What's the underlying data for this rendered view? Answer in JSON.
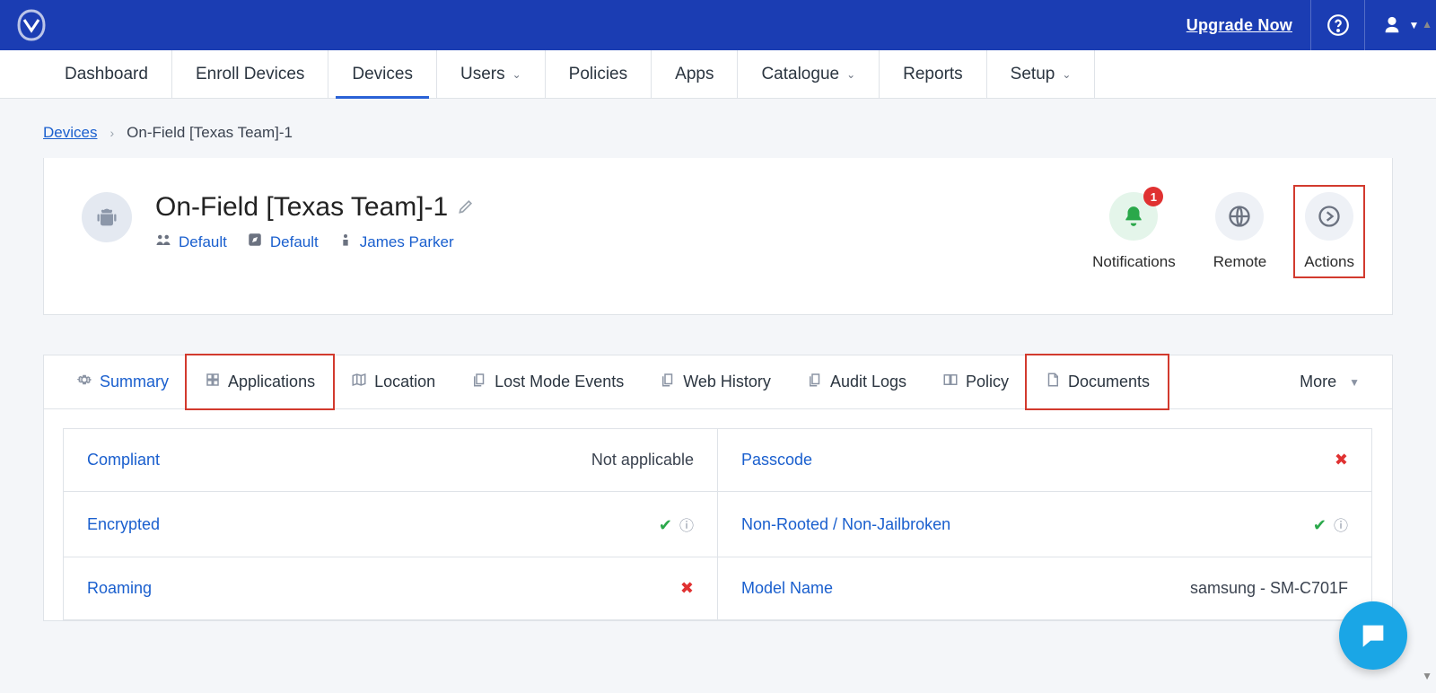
{
  "topbar": {
    "upgrade_label": "Upgrade Now"
  },
  "nav": [
    {
      "label": "Dashboard",
      "dropdown": false,
      "active": false
    },
    {
      "label": "Enroll Devices",
      "dropdown": false,
      "active": false
    },
    {
      "label": "Devices",
      "dropdown": false,
      "active": true
    },
    {
      "label": "Users",
      "dropdown": true,
      "active": false
    },
    {
      "label": "Policies",
      "dropdown": false,
      "active": false
    },
    {
      "label": "Apps",
      "dropdown": false,
      "active": false
    },
    {
      "label": "Catalogue",
      "dropdown": true,
      "active": false
    },
    {
      "label": "Reports",
      "dropdown": false,
      "active": false
    },
    {
      "label": "Setup",
      "dropdown": true,
      "active": false
    }
  ],
  "breadcrumb": {
    "root": "Devices",
    "current": "On-Field [Texas Team]-1"
  },
  "device": {
    "name": "On-Field [Texas Team]-1",
    "group": "Default",
    "profile": "Default",
    "owner": "James Parker"
  },
  "actions": {
    "notifications": {
      "label": "Notifications",
      "badge": "1"
    },
    "remote": {
      "label": "Remote"
    },
    "actions": {
      "label": "Actions"
    }
  },
  "tabs": [
    {
      "label": "Summary",
      "icon": "gear",
      "active": true,
      "highlight": false
    },
    {
      "label": "Applications",
      "icon": "grid",
      "active": false,
      "highlight": true
    },
    {
      "label": "Location",
      "icon": "map",
      "active": false,
      "highlight": false
    },
    {
      "label": "Lost Mode Events",
      "icon": "copy",
      "active": false,
      "highlight": false
    },
    {
      "label": "Web History",
      "icon": "copy",
      "active": false,
      "highlight": false
    },
    {
      "label": "Audit Logs",
      "icon": "copy",
      "active": false,
      "highlight": false
    },
    {
      "label": "Policy",
      "icon": "book",
      "active": false,
      "highlight": false
    },
    {
      "label": "Documents",
      "icon": "doc",
      "active": false,
      "highlight": true
    }
  ],
  "more_label": "More",
  "summary_rows": [
    [
      {
        "label": "Compliant",
        "value_text": "Not applicable",
        "status": null,
        "info": false
      },
      {
        "label": "Passcode",
        "value_text": null,
        "status": "bad",
        "info": false
      }
    ],
    [
      {
        "label": "Encrypted",
        "value_text": null,
        "status": "ok",
        "info": true
      },
      {
        "label": "Non-Rooted / Non-Jailbroken",
        "value_text": null,
        "status": "ok",
        "info": true
      }
    ],
    [
      {
        "label": "Roaming",
        "value_text": null,
        "status": "bad",
        "info": false
      },
      {
        "label": "Model Name",
        "value_text": "samsung - SM-C701F",
        "status": null,
        "info": false
      }
    ]
  ]
}
